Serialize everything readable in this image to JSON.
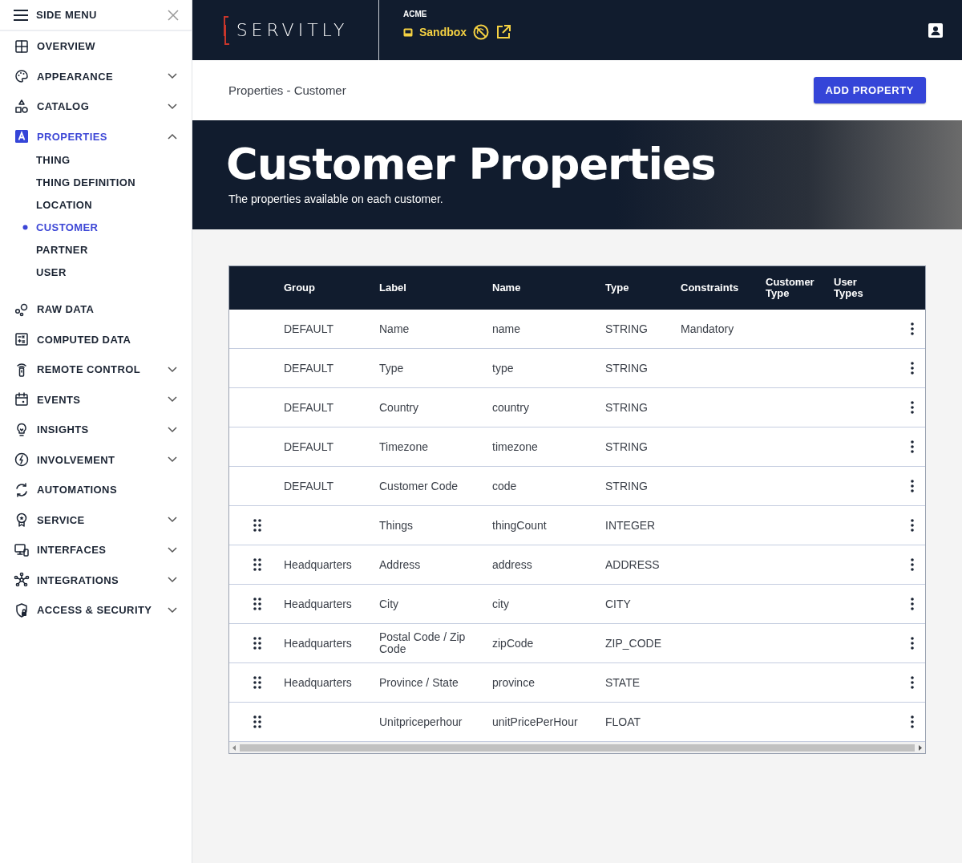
{
  "side_menu": {
    "title": "SIDE MENU",
    "items": [
      {
        "label": "OVERVIEW",
        "selected": false
      },
      {
        "label": "APPEARANCE",
        "selected": false,
        "expanded": false
      },
      {
        "label": "CATALOG",
        "selected": false,
        "expanded": false
      },
      {
        "label": "PROPERTIES",
        "selected": true,
        "expanded": true,
        "children": [
          {
            "label": "THING",
            "selected": false
          },
          {
            "label": "THING DEFINITION",
            "selected": false
          },
          {
            "label": "LOCATION",
            "selected": false
          },
          {
            "label": "CUSTOMER",
            "selected": true
          },
          {
            "label": "PARTNER",
            "selected": false
          },
          {
            "label": "USER",
            "selected": false
          }
        ]
      },
      {
        "label": "RAW DATA",
        "selected": false
      },
      {
        "label": "COMPUTED DATA",
        "selected": false
      },
      {
        "label": "REMOTE CONTROL",
        "selected": false,
        "expanded": false
      },
      {
        "label": "EVENTS",
        "selected": false,
        "expanded": false
      },
      {
        "label": "INSIGHTS",
        "selected": false,
        "expanded": false
      },
      {
        "label": "INVOLVEMENT",
        "selected": false,
        "expanded": false
      },
      {
        "label": "AUTOMATIONS",
        "selected": false
      },
      {
        "label": "SERVICE",
        "selected": false,
        "expanded": false
      },
      {
        "label": "INTERFACES",
        "selected": false,
        "expanded": false
      },
      {
        "label": "INTEGRATIONS",
        "selected": false,
        "expanded": false
      },
      {
        "label": "ACCESS & SECURITY",
        "selected": false,
        "expanded": false
      }
    ]
  },
  "top_bar": {
    "logo": "SERVITLY",
    "tenant": "ACME",
    "environment": "Sandbox"
  },
  "page_header": {
    "breadcrumb": "Properties - Customer",
    "button": "ADD PROPERTY"
  },
  "hero": {
    "title": "Customer Properties",
    "subtitle": "The properties available on each customer."
  },
  "table": {
    "columns": [
      "Group",
      "Label",
      "Name",
      "Type",
      "Constraints",
      "Customer Type",
      "User Types"
    ],
    "rows": [
      {
        "draggable": false,
        "cells": [
          "DEFAULT",
          "Name",
          "name",
          "STRING",
          "Mandatory",
          "",
          ""
        ]
      },
      {
        "draggable": false,
        "cells": [
          "DEFAULT",
          "Type",
          "type",
          "STRING",
          "",
          "",
          ""
        ]
      },
      {
        "draggable": false,
        "cells": [
          "DEFAULT",
          "Country",
          "country",
          "STRING",
          "",
          "",
          ""
        ]
      },
      {
        "draggable": false,
        "cells": [
          "DEFAULT",
          "Timezone",
          "timezone",
          "STRING",
          "",
          "",
          ""
        ]
      },
      {
        "draggable": false,
        "cells": [
          "DEFAULT",
          "Customer Code",
          "code",
          "STRING",
          "",
          "",
          ""
        ]
      },
      {
        "draggable": true,
        "cells": [
          "",
          "Things",
          "thingCount",
          "INTEGER",
          "",
          "",
          ""
        ]
      },
      {
        "draggable": true,
        "cells": [
          "Headquarters",
          "Address",
          "address",
          "ADDRESS",
          "",
          "",
          ""
        ]
      },
      {
        "draggable": true,
        "cells": [
          "Headquarters",
          "City",
          "city",
          "CITY",
          "",
          "",
          ""
        ]
      },
      {
        "draggable": true,
        "cells": [
          "Headquarters",
          "Postal Code / Zip Code",
          "zipCode",
          "ZIP_CODE",
          "",
          "",
          ""
        ]
      },
      {
        "draggable": true,
        "cells": [
          "Headquarters",
          "Province / State",
          "province",
          "STATE",
          "",
          "",
          ""
        ]
      },
      {
        "draggable": true,
        "cells": [
          "",
          "Unitpriceperhour",
          "unitPricePerHour",
          "FLOAT",
          "",
          "",
          ""
        ]
      }
    ]
  }
}
